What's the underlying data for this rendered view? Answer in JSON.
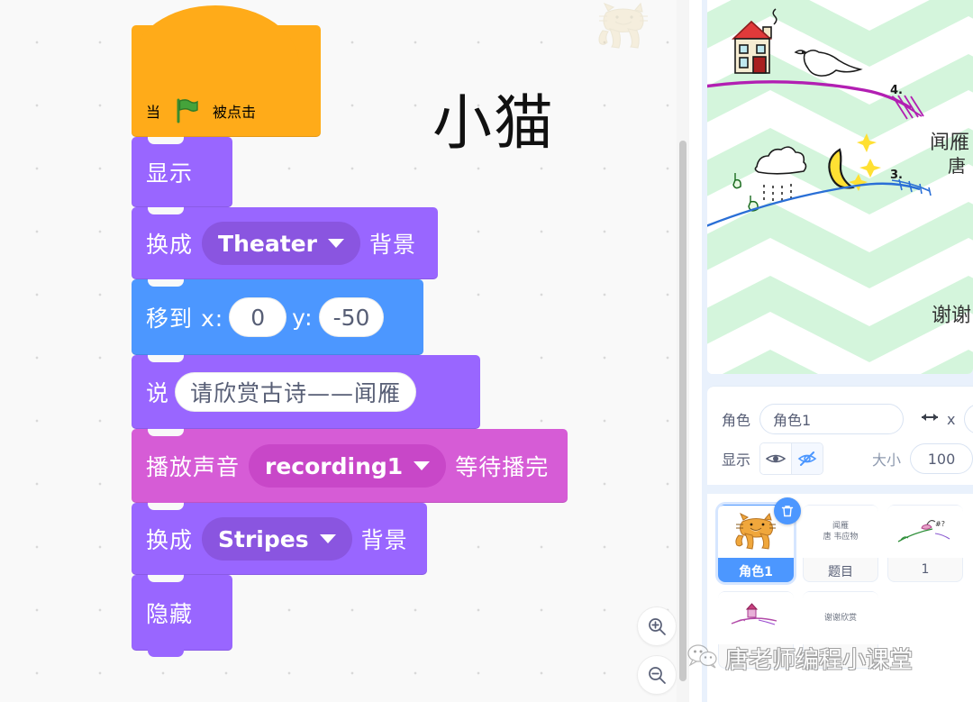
{
  "canvas": {
    "annotation_label": "小猫",
    "cat_watermark_icon": "scratch-cat-icon",
    "zoom_in_icon": "zoom-in-icon",
    "zoom_out_icon": "zoom-out-icon",
    "grid_dot_color": "#d9d9d9",
    "background_color": "#f9f9f9"
  },
  "script": {
    "blocks": [
      {
        "id": "when-flag-clicked",
        "category": "events",
        "color": "#ffab19",
        "label_before": "当",
        "icon": "green-flag-icon",
        "label_after": "被点击"
      },
      {
        "id": "show",
        "category": "looks",
        "color": "#9966ff",
        "label": "显示"
      },
      {
        "id": "switch-backdrop-theater",
        "category": "looks",
        "color": "#9966ff",
        "label_before": "换成",
        "dropdown_value": "Theater",
        "label_after": "背景",
        "dropdown_icon": "chevron-down-icon"
      },
      {
        "id": "go-to-xy",
        "category": "motion",
        "color": "#4c97ff",
        "label_before": "移到 x:",
        "x_value": "0",
        "label_mid": "y:",
        "y_value": "-50"
      },
      {
        "id": "say",
        "category": "looks",
        "color": "#9966ff",
        "label_before": "说",
        "text_value": "请欣赏古诗——闻雁"
      },
      {
        "id": "play-sound-until-done",
        "category": "sound",
        "color": "#d65cd6",
        "label_before": "播放声音",
        "dropdown_value": "recording1",
        "label_after": "等待播完",
        "dropdown_icon": "chevron-down-icon"
      },
      {
        "id": "switch-backdrop-stripes",
        "category": "looks",
        "color": "#9966ff",
        "label_before": "换成",
        "dropdown_value": "Stripes",
        "label_after": "背景",
        "dropdown_icon": "chevron-down-icon"
      },
      {
        "id": "hide",
        "category": "looks",
        "color": "#9966ff",
        "label": "隐藏"
      }
    ]
  },
  "stage": {
    "title_text": "闻雁",
    "author_text": "唐",
    "thanks_text": "谢谢",
    "marker_3": "3.",
    "marker_4": "4.",
    "backdrop_pattern_color": "#d6f5dd",
    "house_roof_color": "#e03a3a",
    "moon_color": "#ffe033",
    "hill_line_purple": "#b21fb2",
    "hill_line_blue": "#2a6fd6"
  },
  "sprite_info": {
    "name_label": "角色",
    "name_value": "角色1",
    "name_placeholder": "角色1",
    "direction_icon": "horizontal-arrows-icon",
    "x_label": "x",
    "x_value": "",
    "show_label": "显示",
    "show_icon": "eye-icon",
    "hide_icon": "eye-slash-icon",
    "show_active": false,
    "hide_active": true,
    "size_label": "大小",
    "size_value": "100"
  },
  "sprite_list": {
    "delete_badge_icon": "trash-icon",
    "sprites": [
      {
        "name": "角色1",
        "thumb_kind": "cat",
        "thumb_text": "",
        "selected": true
      },
      {
        "name": "题目",
        "thumb_kind": "text",
        "thumb_text": "闻雁\n唐 韦应物",
        "selected": false
      },
      {
        "name": "1",
        "thumb_kind": "drawing-1",
        "thumb_text": "",
        "selected": false
      },
      {
        "name": "",
        "thumb_kind": "drawing-2",
        "thumb_text": "",
        "selected": false
      },
      {
        "name": "",
        "thumb_kind": "text",
        "thumb_text": "谢谢欣赏",
        "selected": false
      }
    ]
  },
  "watermark": {
    "icon": "wechat-icon",
    "text": "唐老师编程小课堂"
  }
}
